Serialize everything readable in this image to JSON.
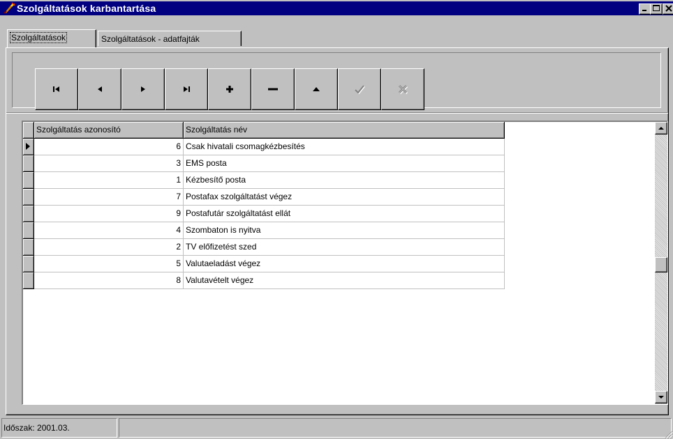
{
  "window": {
    "title": "Szolgáltatások karbantartása",
    "controls": {
      "minimize": "_",
      "maximize": "□",
      "close": "✕"
    }
  },
  "tabs": [
    {
      "label": "Szolgáltatások",
      "active": true
    },
    {
      "label": "Szolgáltatások - adatfajták",
      "active": false
    }
  ],
  "navigator": {
    "buttons": [
      {
        "name": "first-record-button",
        "icon": "first-icon",
        "enabled": true
      },
      {
        "name": "prior-record-button",
        "icon": "prior-icon",
        "enabled": true
      },
      {
        "name": "next-record-button",
        "icon": "next-icon",
        "enabled": true
      },
      {
        "name": "last-record-button",
        "icon": "last-icon",
        "enabled": true
      },
      {
        "name": "insert-record-button",
        "icon": "plus-icon",
        "enabled": true
      },
      {
        "name": "delete-record-button",
        "icon": "minus-icon",
        "enabled": true
      },
      {
        "name": "edit-record-button",
        "icon": "up-triangle-icon",
        "enabled": true
      },
      {
        "name": "post-record-button",
        "icon": "check-icon",
        "enabled": false
      },
      {
        "name": "cancel-record-button",
        "icon": "cancel-icon",
        "enabled": false
      }
    ]
  },
  "grid": {
    "columns": [
      "Szolgáltatás azonosító",
      "Szolgáltatás név"
    ],
    "current_row": 0,
    "rows": [
      {
        "id": "6",
        "name": "Csak hivatali csomagkézbesítés"
      },
      {
        "id": "3",
        "name": "EMS posta"
      },
      {
        "id": "1",
        "name": "Kézbesítő posta"
      },
      {
        "id": "7",
        "name": "Postafax szolgáltatást végez"
      },
      {
        "id": "9",
        "name": "Postafutár szolgáltatást ellát"
      },
      {
        "id": "4",
        "name": "Szombaton is nyitva"
      },
      {
        "id": "2",
        "name": "TV előfizetést szed"
      },
      {
        "id": "5",
        "name": "Valutaeladást végez"
      },
      {
        "id": "8",
        "name": "Valutavételt végez"
      }
    ]
  },
  "status": {
    "period": "Időszak: 2001.03.",
    "second_pane": ""
  },
  "colors": {
    "titlebar": "#000080",
    "face": "#c0c0c0",
    "grid_bg": "#ffffff"
  }
}
